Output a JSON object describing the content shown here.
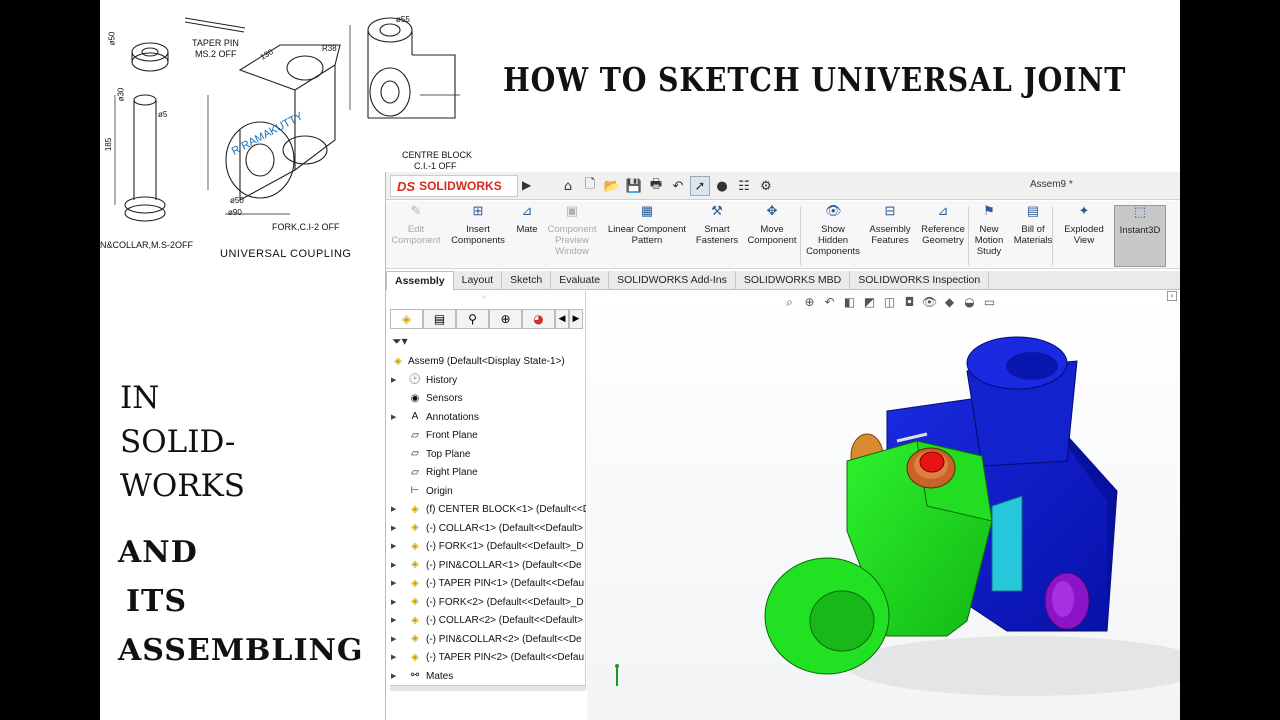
{
  "headline": "HOW TO SKETCH UNIVERSAL JOINT",
  "side_text_a": [
    "IN",
    "SOLID-",
    "WORKS"
  ],
  "side_text_b": [
    "AND",
    "ITS",
    "ASSEMBLING"
  ],
  "drawing": {
    "labels": {
      "taper_pin": "TAPER PIN",
      "taper_pin_mat": "MS.2 OFF",
      "centre_block": "CENTRE BLOCK",
      "centre_block_mat": "C.I.-1 OFF",
      "fork": "FORK,C.I-2 OFF",
      "pin_collar": "N&COLLAR,M.S-2OFF",
      "universal_coupling": "UNIVERSAL COUPLING",
      "author": "R RAMAKUTTY"
    },
    "dims": [
      "ø50",
      "ø30",
      "ø30",
      "185",
      "20",
      "ø5",
      "130",
      "R38",
      "56",
      "38",
      "65",
      "ø50",
      "ø90",
      "ø55",
      "55",
      "55",
      "55",
      "38",
      "ø30",
      "ø55"
    ]
  },
  "solidworks": {
    "brand": "SOLIDWORKS",
    "brand_mark": "DS",
    "document_title": "Assem9 *",
    "ribbon": [
      {
        "label": "Edit\nComponent",
        "enabled": false,
        "active": false
      },
      {
        "label": "Insert\nComponents",
        "enabled": true,
        "active": false
      },
      {
        "label": "Mate",
        "enabled": true,
        "active": false
      },
      {
        "label": "Component\nPreview\nWindow",
        "enabled": false,
        "active": false
      },
      {
        "label": "Linear Component\nPattern",
        "enabled": true,
        "active": false
      },
      {
        "label": "Smart\nFasteners",
        "enabled": true,
        "active": false
      },
      {
        "label": "Move\nComponent",
        "enabled": true,
        "active": false
      },
      {
        "label": "Show\nHidden\nComponents",
        "enabled": true,
        "active": false
      },
      {
        "label": "Assembly\nFeatures",
        "enabled": true,
        "active": false
      },
      {
        "label": "Reference\nGeometry",
        "enabled": true,
        "active": false
      },
      {
        "label": "New\nMotion\nStudy",
        "enabled": true,
        "active": false
      },
      {
        "label": "Bill of\nMaterials",
        "enabled": true,
        "active": false
      },
      {
        "label": "Exploded\nView",
        "enabled": true,
        "active": false
      },
      {
        "label": "Instant3D",
        "enabled": true,
        "active": true
      }
    ],
    "tabs": [
      "Assembly",
      "Layout",
      "Sketch",
      "Evaluate",
      "SOLIDWORKS Add-Ins",
      "SOLIDWORKS MBD",
      "SOLIDWORKS Inspection"
    ],
    "active_tab": "Assembly",
    "tree": {
      "root": "Assem9  (Default<Display State-1>)",
      "items": [
        {
          "label": "History",
          "icon": "history-icon",
          "expandable": true
        },
        {
          "label": "Sensors",
          "icon": "sensors-icon",
          "expandable": false
        },
        {
          "label": "Annotations",
          "icon": "annotations-icon",
          "expandable": true
        },
        {
          "label": "Front Plane",
          "icon": "plane-icon",
          "expandable": false
        },
        {
          "label": "Top Plane",
          "icon": "plane-icon",
          "expandable": false
        },
        {
          "label": "Right Plane",
          "icon": "plane-icon",
          "expandable": false
        },
        {
          "label": "Origin",
          "icon": "origin-icon",
          "expandable": false
        },
        {
          "label": "(f) CENTER BLOCK<1> (Default<<D",
          "icon": "part-icon",
          "expandable": true
        },
        {
          "label": "(-) COLLAR<1> (Default<<Default>",
          "icon": "part-icon",
          "expandable": true
        },
        {
          "label": "(-) FORK<1> (Default<<Default>_D",
          "icon": "part-icon",
          "expandable": true
        },
        {
          "label": "(-) PIN&COLLAR<1> (Default<<De",
          "icon": "part-icon",
          "expandable": true
        },
        {
          "label": "(-) TAPER PIN<1> (Default<<Defau",
          "icon": "part-icon",
          "expandable": true
        },
        {
          "label": "(-) FORK<2> (Default<<Default>_D",
          "icon": "part-icon",
          "expandable": true
        },
        {
          "label": "(-) COLLAR<2> (Default<<Default>",
          "icon": "part-icon",
          "expandable": true
        },
        {
          "label": "(-) PIN&COLLAR<2> (Default<<De",
          "icon": "part-icon",
          "expandable": true
        },
        {
          "label": "(-) TAPER PIN<2> (Default<<Defau",
          "icon": "part-icon",
          "expandable": true
        },
        {
          "label": "Mates",
          "icon": "mates-icon",
          "expandable": true
        }
      ]
    },
    "colors": {
      "center_block": "#0a14c8",
      "fork": "#1ee61e",
      "collar": "#c86428",
      "pin_head": "#e61414",
      "pin_collar_purple": "#8c14c8",
      "cyan_part": "#28c8dc"
    }
  }
}
